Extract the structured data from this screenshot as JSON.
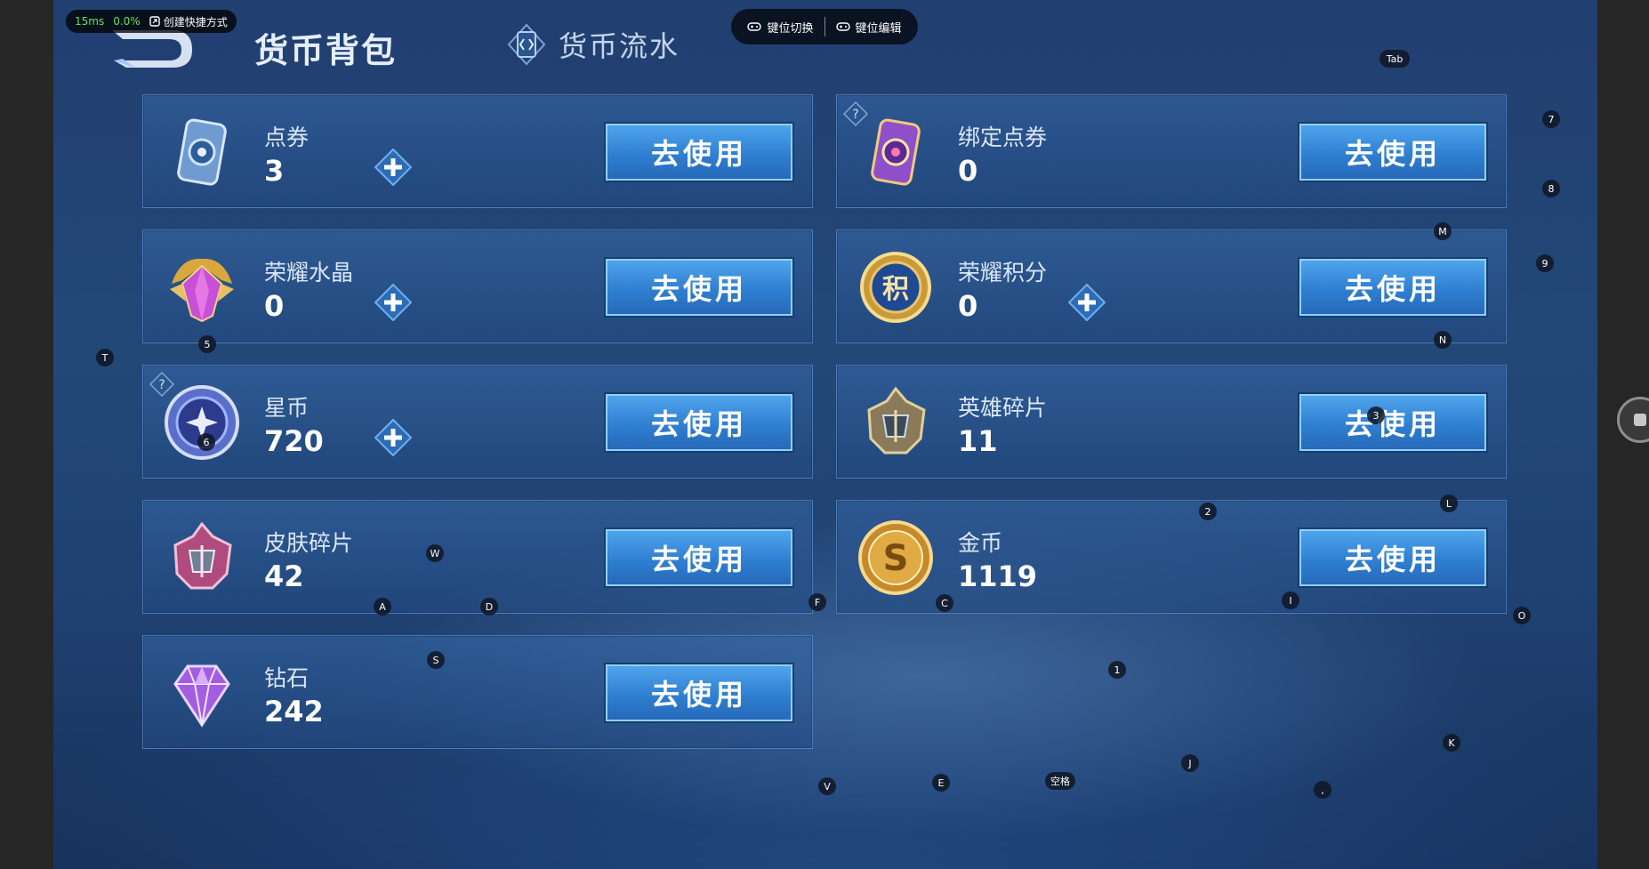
{
  "overlay": {
    "latency": "15ms",
    "loss": "0.0%",
    "shortcut_label": "创建快捷方式",
    "key_switch_label": "键位切换",
    "key_edit_label": "键位编辑"
  },
  "header": {
    "title": "货币背包",
    "tab_flow_label": "货币流水"
  },
  "action_label": "去使用",
  "currencies": [
    {
      "name": "点券",
      "value": "3",
      "icon": "coupon-icon"
    },
    {
      "name": "绑定点券",
      "value": "0",
      "icon": "bound-coupon-icon"
    },
    {
      "name": "荣耀水晶",
      "value": "0",
      "icon": "glory-crystal-icon"
    },
    {
      "name": "荣耀积分",
      "value": "0",
      "icon": "glory-points-icon",
      "badge": "积"
    },
    {
      "name": "星币",
      "value": "720",
      "icon": "star-coin-icon"
    },
    {
      "name": "英雄碎片",
      "value": "11",
      "icon": "hero-fragment-icon"
    },
    {
      "name": "皮肤碎片",
      "value": "42",
      "icon": "skin-fragment-icon"
    },
    {
      "name": "金币",
      "value": "1119",
      "icon": "gold-coin-icon",
      "badge": "S"
    },
    {
      "name": "钻石",
      "value": "242",
      "icon": "diamond-icon"
    }
  ],
  "key_hints": {
    "tab": "Tab",
    "k7": "7",
    "k8": "8",
    "m": "M",
    "k9": "9",
    "n": "N",
    "k5": "5",
    "t": "T",
    "k6": "6",
    "k3": "3",
    "k2": "2",
    "l": "L",
    "w": "W",
    "a": "A",
    "d": "D",
    "f": "F",
    "c": "C",
    "i": "I",
    "o": "O",
    "s": "S",
    "k1": "1",
    "j": "J",
    "k": "K",
    "v": "V",
    "e": "E",
    "space": "空格",
    "comma": ","
  },
  "colors": {
    "button_blue": "#3a8fe0",
    "background_blue": "#234878",
    "overlay_green": "#5fe35f"
  }
}
